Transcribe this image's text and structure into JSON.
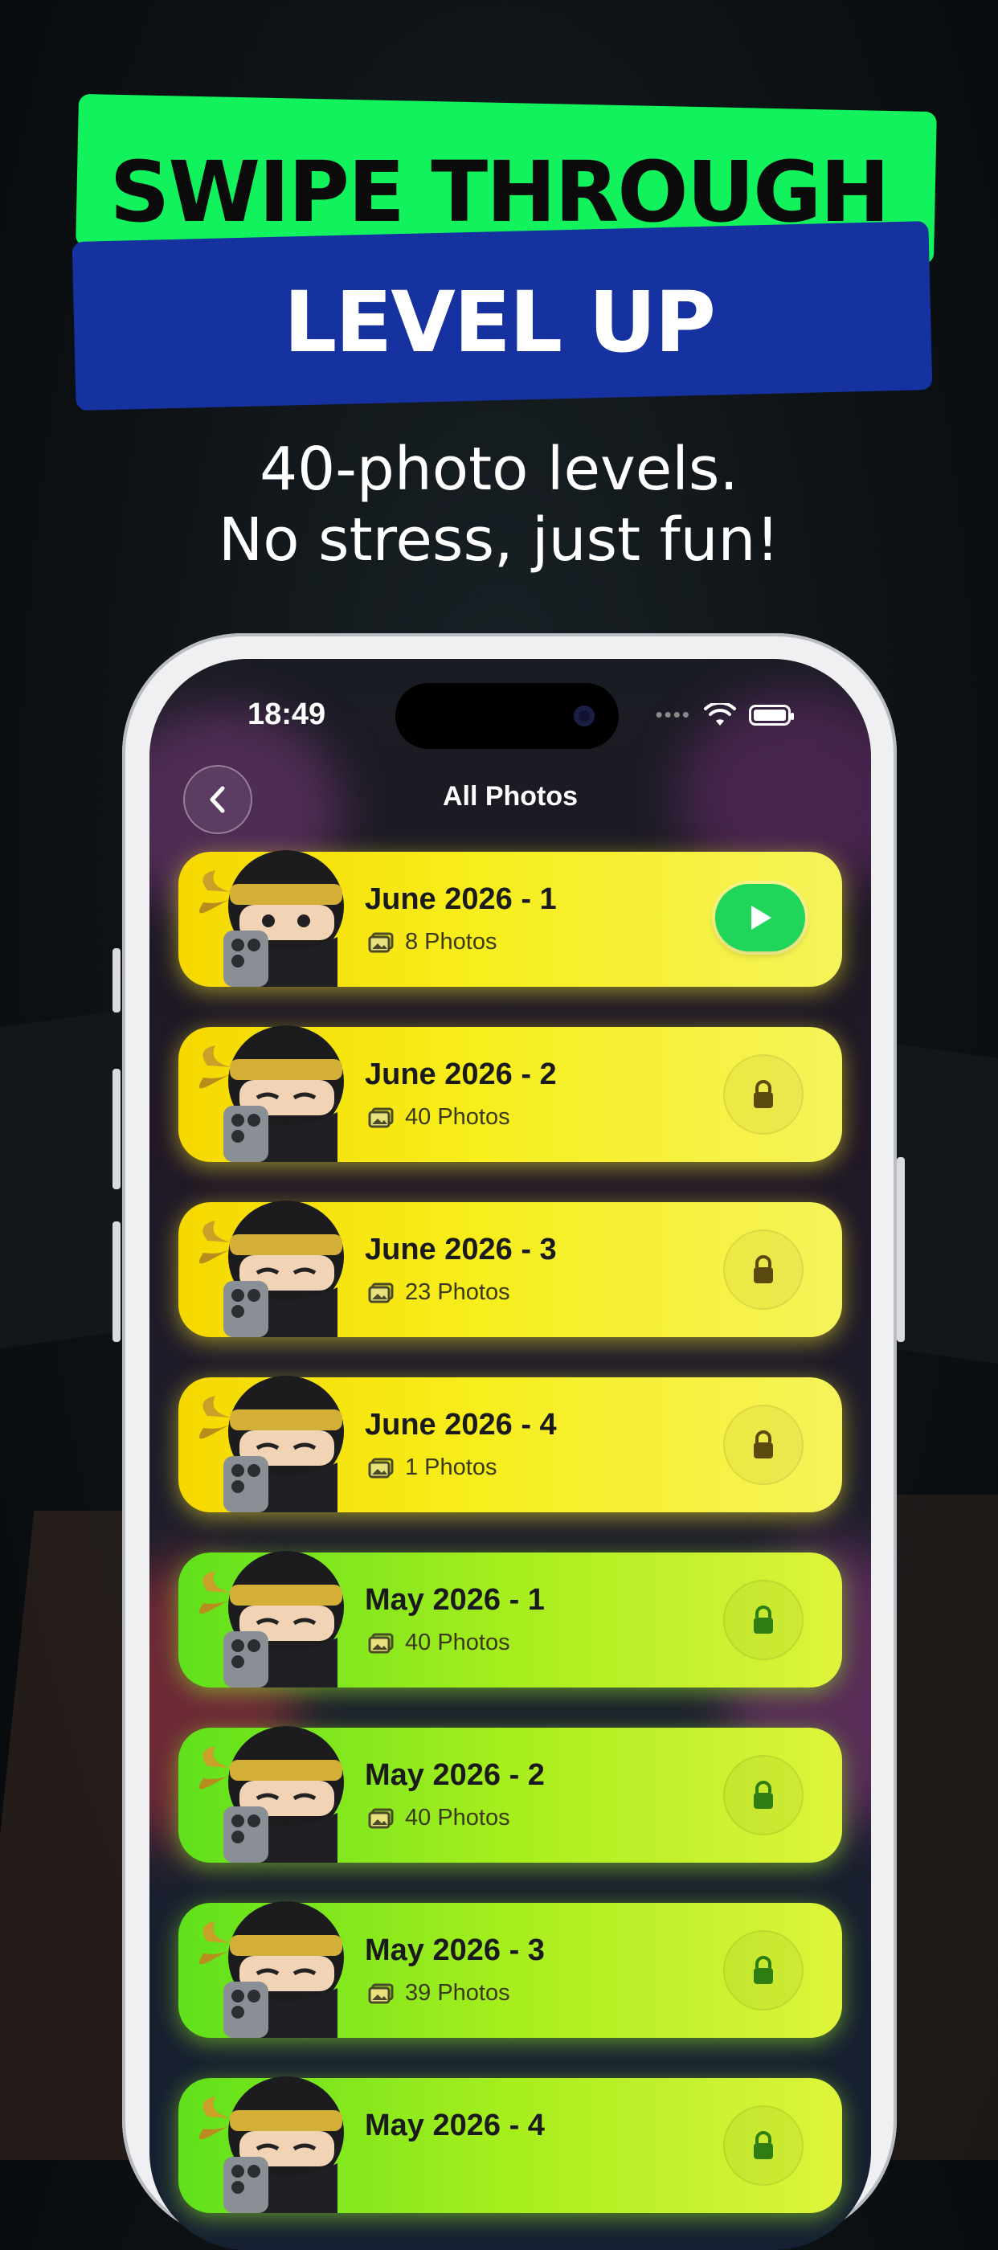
{
  "headline": {
    "line1": "SWIPE THROUGH",
    "line2": "LEVEL UP"
  },
  "subtitle": {
    "line1": "40-photo levels.",
    "line2": "No stress, just fun!"
  },
  "colors": {
    "banner_green": "#12f25c",
    "banner_blue": "#1532a0",
    "card_yellow": "#f7ee1c",
    "card_green": "#8fe81e",
    "play_green": "#1fd65a"
  },
  "status_bar": {
    "time": "18:49",
    "icons": [
      "signal-dots-icon",
      "wifi-icon",
      "battery-icon"
    ]
  },
  "nav": {
    "back_icon": "chevron-left-icon",
    "title": "All Photos"
  },
  "levels": [
    {
      "title": "June 2026 - 1",
      "count": "8 Photos",
      "state": "play",
      "color": "yellow"
    },
    {
      "title": "June 2026 - 2",
      "count": "40 Photos",
      "state": "locked",
      "color": "yellow"
    },
    {
      "title": "June 2026 - 3",
      "count": "23 Photos",
      "state": "locked",
      "color": "yellow"
    },
    {
      "title": "June 2026 - 4",
      "count": "1 Photos",
      "state": "locked",
      "color": "yellow"
    },
    {
      "title": "May 2026 - 1",
      "count": "40 Photos",
      "state": "locked",
      "color": "green"
    },
    {
      "title": "May 2026 - 2",
      "count": "40 Photos",
      "state": "locked",
      "color": "green"
    },
    {
      "title": "May 2026 - 3",
      "count": "39 Photos",
      "state": "locked",
      "color": "green"
    },
    {
      "title": "May 2026 - 4",
      "count": "",
      "state": "locked",
      "color": "green"
    }
  ]
}
